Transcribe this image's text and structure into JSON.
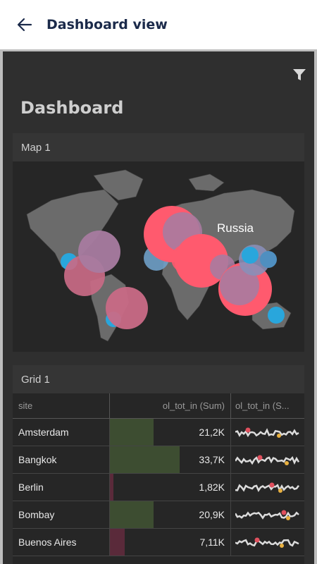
{
  "appbar": {
    "title": "Dashboard view",
    "back_icon": "arrow-left-icon"
  },
  "dashboard": {
    "title": "Dashboard",
    "filter_icon": "filter-icon"
  },
  "map_card": {
    "title": "Map 1",
    "highlight_label": "Russia"
  },
  "grid_card": {
    "title": "Grid 1",
    "columns": [
      "site",
      "ol_tot_in (Sum)",
      "ol_tot_in (S..."
    ],
    "rows": [
      {
        "site": "Amsterdam",
        "value": "21,2K",
        "bar_fraction": 0.36,
        "bar_color": "#3d4d31"
      },
      {
        "site": "Bangkok",
        "value": "33,7K",
        "bar_fraction": 0.58,
        "bar_color": "#3d4d31"
      },
      {
        "site": "Berlin",
        "value": "1,82K",
        "bar_fraction": 0.03,
        "bar_color": "#5a2a3a"
      },
      {
        "site": "Bombay",
        "value": "20,9K",
        "bar_fraction": 0.36,
        "bar_color": "#3d4d31"
      },
      {
        "site": "Buenos Aires",
        "value": "7,11K",
        "bar_fraction": 0.12,
        "bar_color": "#5a2a3a"
      }
    ]
  },
  "colors": {
    "bubble_red": "#ff5a6e",
    "bubble_purple": "#a87ba0",
    "bubble_blue": "#29a6dc",
    "land": "#6b6b6b"
  }
}
